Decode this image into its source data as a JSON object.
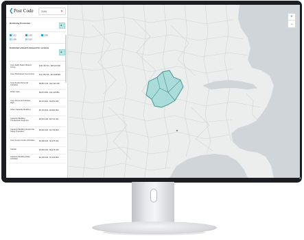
{
  "sidebar": {
    "title": "Post Code",
    "selected_postcode": "2194",
    "section1_label": "Bordering Postcodes",
    "postcodes": [
      "2131",
      "2193",
      "2196",
      "2198",
      "2203"
    ],
    "section2_label": "Estimated annual $ demand for services",
    "rows": [
      {
        "name": "Core Daily Tasks Shared Living",
        "value": "$18,748,734 - $38,116,900"
      },
      {
        "name": "Core Participate Community",
        "value": "$12,785,735 - $15,998,893"
      },
      {
        "name": "Core Assist Personal Activities",
        "value": "$8,887,193 - $12,316,300"
      },
      {
        "name": "Other Care",
        "value": "$9,872,083 - $11,415,856"
      },
      {
        "name": "Core Personal Activities High",
        "value": "$6,470,893 - $9,651,605"
      },
      {
        "name": "Other Capacity Building",
        "value": "$5,787,849 - $6,682,890"
      },
      {
        "name": "Capacity Building Therapeutic Supports",
        "value": "$4,533,196 - $5,722,362"
      },
      {
        "name": "Capacity Building Assist Life Stage Transition",
        "value": "$3,662,326 - $4,736,890"
      },
      {
        "name": "Core Group Centre Activities",
        "value": "$3,182,606 - $4,275,330"
      },
      {
        "name": "Capital",
        "value": "$1,893,326 - $3,479,030"
      },
      {
        "name": "Capacity Building Daily Activities",
        "value": "$2,135,209 - $3,109,890"
      }
    ]
  },
  "icons": {
    "back": "chevron-left-icon",
    "close": "close-icon",
    "collapse": "chevron-up-icon",
    "zoom_in": "plus-icon",
    "zoom_out": "minus-icon"
  },
  "zoom": {
    "in_label": "+",
    "out_label": "−"
  },
  "colors": {
    "accent": "#1f8fb0",
    "highlight_fill": "#9fd9d6",
    "highlight_stroke": "#3a8f8c",
    "water": "#cfd5d8",
    "land": "#eceeed"
  }
}
